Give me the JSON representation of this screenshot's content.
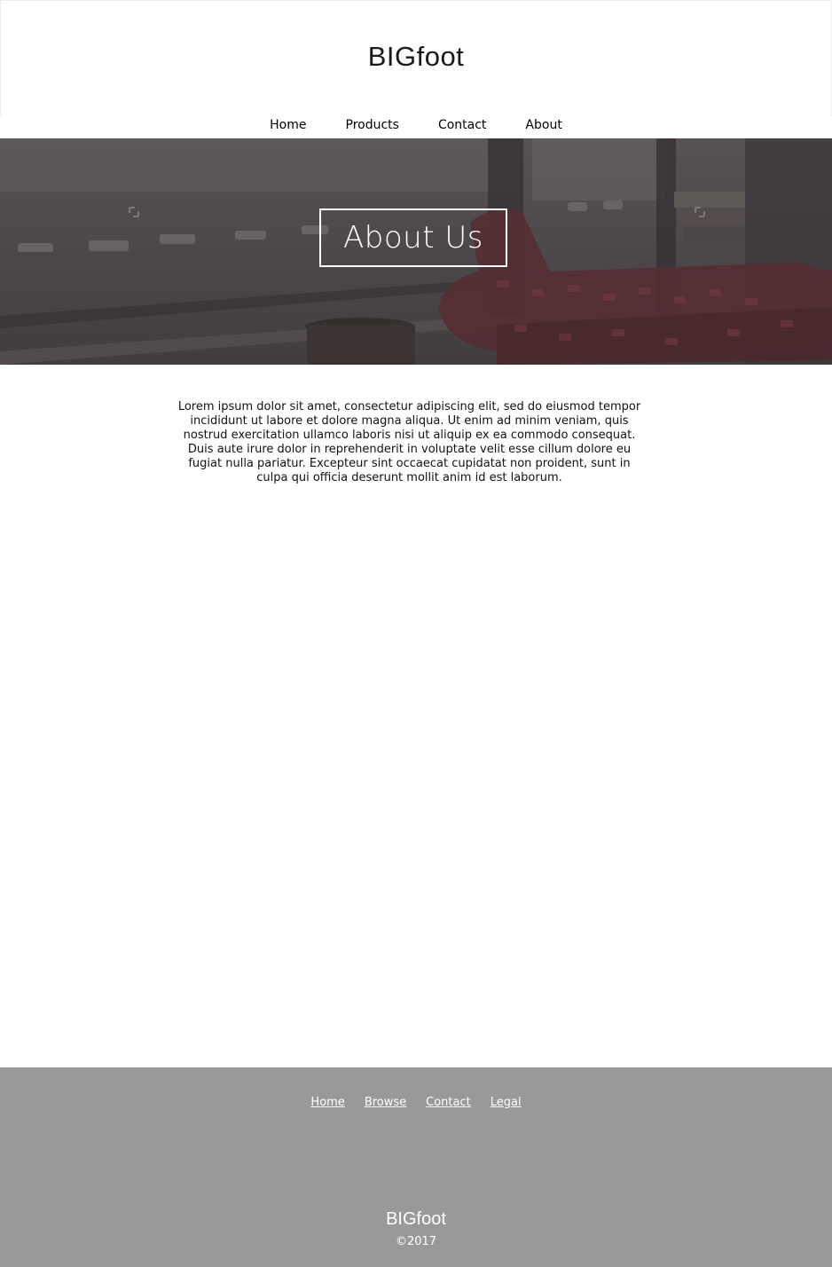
{
  "header": {
    "logo": "BIGfoot",
    "nav": [
      "Home",
      "Products",
      "Contact",
      "About"
    ]
  },
  "hero": {
    "title": "About Us",
    "overlay_color": "#5a5658"
  },
  "content": {
    "paragraph": "Lorem ipsum dolor sit amet, consectetur adipiscing elit, sed do eiusmod tempor incididunt ut labore et dolore magna aliqua. Ut enim ad minim veniam, quis nostrud exercitation ullamco laboris nisi ut aliquip ex ea commodo consequat. Duis aute irure dolor in reprehenderit in voluptate velit esse cillum dolore eu fugiat nulla pariatur. Excepteur sint occaecat cupidatat non proident, sunt in culpa qui officia deserunt mollit anim id est laborum."
  },
  "footer": {
    "nav": [
      "Home",
      "Browse",
      "Contact",
      "Legal"
    ],
    "logo": "BIGfoot",
    "copyright": "©2017",
    "background": "#999999"
  }
}
